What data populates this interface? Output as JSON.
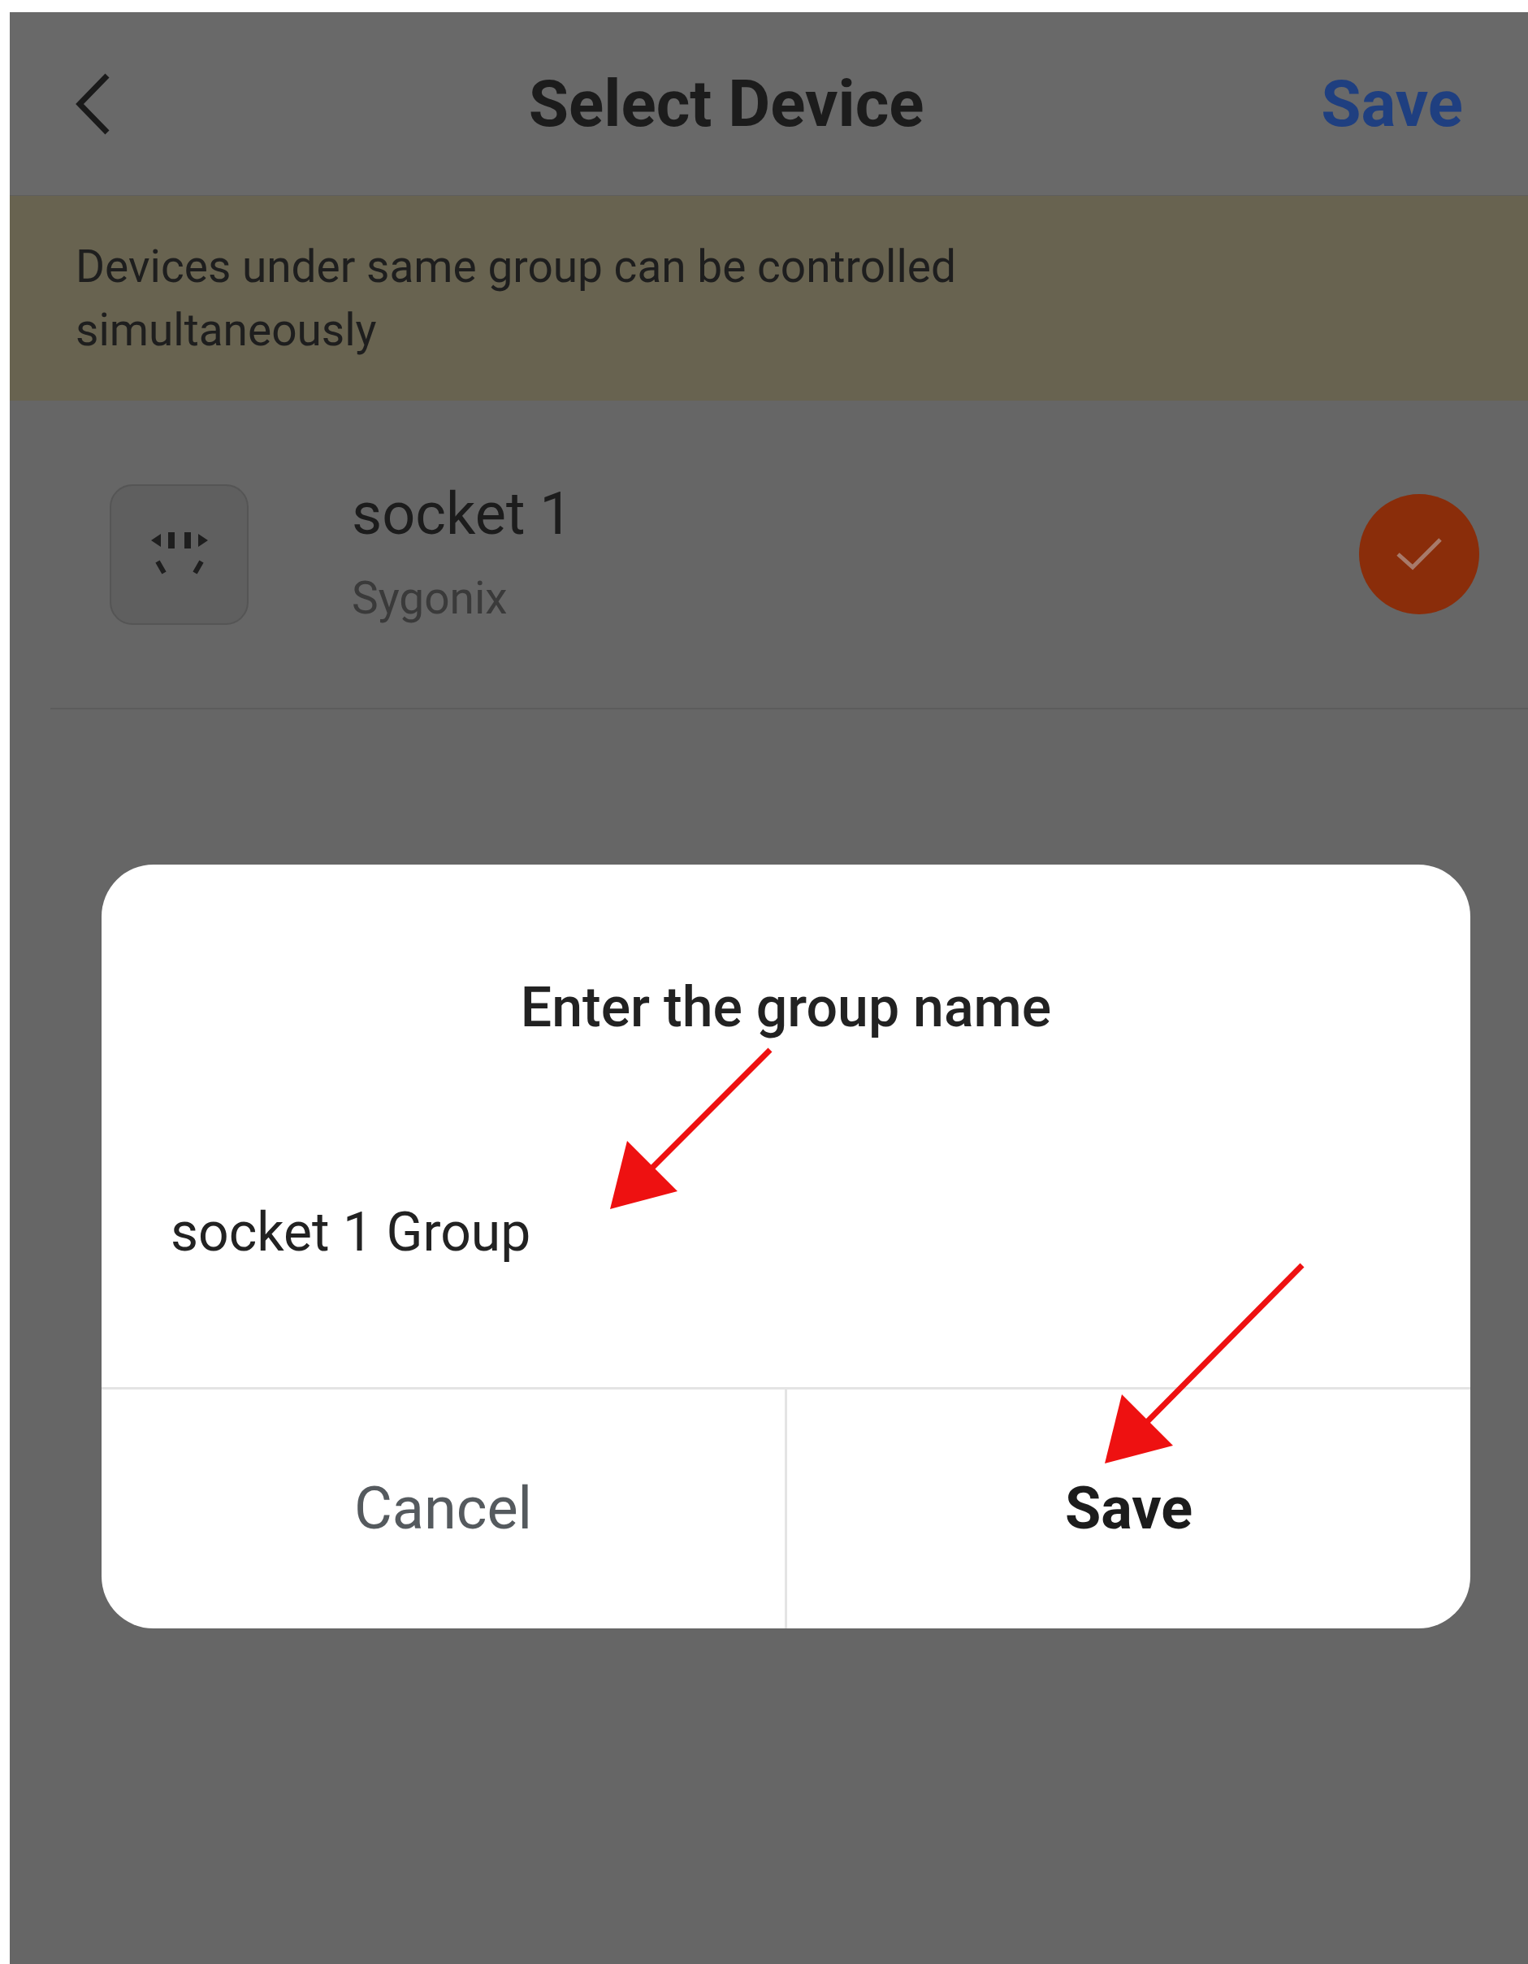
{
  "header": {
    "title": "Select Device",
    "action": "Save"
  },
  "banner": {
    "text": "Devices under same group can be controlled simultaneously"
  },
  "devices": [
    {
      "name": "socket 1",
      "brand": "Sygonix",
      "selected": true
    }
  ],
  "dialog": {
    "title": "Enter the group name",
    "value": "socket 1 Group",
    "buttons": [
      {
        "label": "Cancel",
        "kind": "cancel"
      },
      {
        "label": "Save",
        "kind": "confirm"
      }
    ]
  }
}
